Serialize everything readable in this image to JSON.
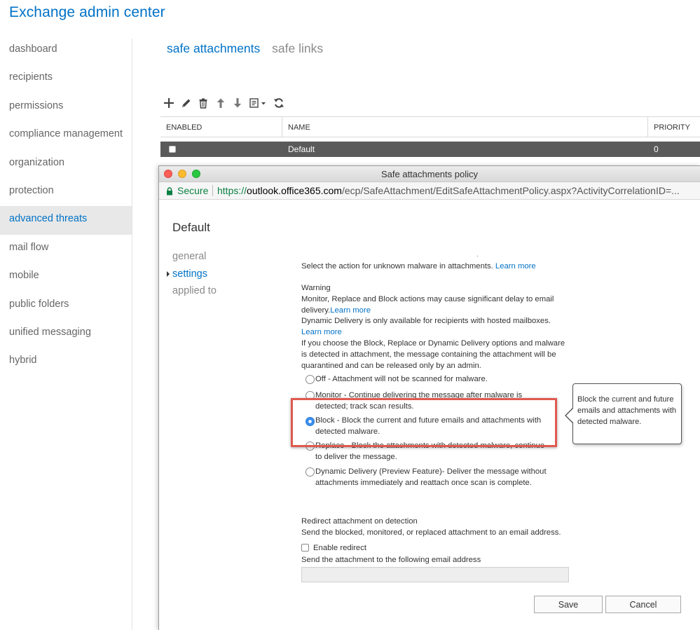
{
  "app": {
    "title": "Exchange admin center"
  },
  "nav": {
    "items": [
      {
        "label": "dashboard"
      },
      {
        "label": "recipients"
      },
      {
        "label": "permissions"
      },
      {
        "label": "compliance management"
      },
      {
        "label": "organization"
      },
      {
        "label": "protection"
      },
      {
        "label": "advanced threats"
      },
      {
        "label": "mail flow"
      },
      {
        "label": "mobile"
      },
      {
        "label": "public folders"
      },
      {
        "label": "unified messaging"
      },
      {
        "label": "hybrid"
      }
    ],
    "active": "advanced threats"
  },
  "tabs": [
    {
      "label": "safe attachments",
      "active": true
    },
    {
      "label": "safe links",
      "active": false
    }
  ],
  "toolbar": {
    "icons": [
      "add-icon",
      "edit-icon",
      "delete-icon",
      "move-up-icon",
      "move-down-icon",
      "export-icon",
      "refresh-icon"
    ]
  },
  "grid": {
    "columns": [
      "ENABLED",
      "NAME",
      "PRIORITY"
    ],
    "rows": [
      {
        "enabled": false,
        "name": "Default",
        "priority": "0",
        "selected": true
      }
    ]
  },
  "popup": {
    "window_title": "Safe attachments policy",
    "url": {
      "secure_label": "Secure",
      "scheme": "https://",
      "host": "outlook.office365.com",
      "path": "/ecp/SafeAttachment/EditSafeAttachmentPolicy.aspx?ActivityCorrelationID=..."
    },
    "policy_name": "Default",
    "side_tabs": [
      {
        "label": "general",
        "active": false
      },
      {
        "label": "settings",
        "active": true
      },
      {
        "label": "applied to",
        "active": false
      }
    ],
    "dot": ".",
    "intro": {
      "text": "Select the action for unknown malware in attachments. ",
      "link": "Learn more"
    },
    "warning": {
      "heading": "Warning",
      "line1": "Monitor, Replace and Block actions may cause significant delay to email delivery.",
      "link1": "Learn more",
      "line2": "Dynamic Delivery is only available for recipients with hosted mailboxes.",
      "link2": "Learn more",
      "line3": "If you choose the Block, Replace or Dynamic Delivery options and malware is detected in attachment, the message containing the attachment will be quarantined and can be released only by an admin."
    },
    "options": [
      {
        "label": "Off - Attachment will not be scanned for malware.",
        "checked": false
      },
      {
        "label": "Monitor - Continue delivering the message after malware is detected; track scan results.",
        "checked": false
      },
      {
        "label": "Block - Block the current and future emails and attachments with detected malware.",
        "checked": true
      },
      {
        "label": "Replace - Block the attachments with detected malware, continue to deliver the message.",
        "checked": false
      },
      {
        "label": "Dynamic Delivery (Preview Feature)- Deliver the message without attachments immediately and reattach once scan is complete.",
        "checked": false
      }
    ],
    "callout": "Block the current and future emails and attachments with detected malware.",
    "redirect": {
      "heading": "Redirect attachment on detection",
      "description": "Send the blocked, monitored, or replaced attachment to an email address.",
      "checkbox_label": "Enable redirect",
      "checkbox_checked": false,
      "email_label": "Send the attachment to the following email address",
      "email_value": ""
    },
    "buttons": {
      "save": "Save",
      "cancel": "Cancel"
    }
  },
  "colors": {
    "accent": "#0072c6",
    "selected_row": "#5a5a5a",
    "highlight_box": "#e05a4f",
    "secure_green": "#0b8043"
  }
}
